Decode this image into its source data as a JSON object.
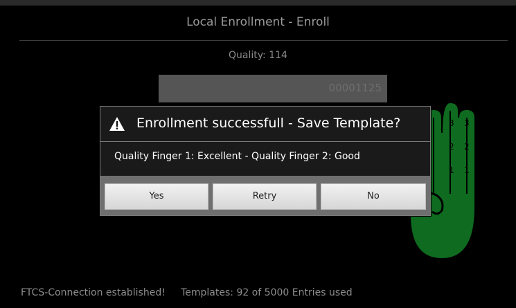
{
  "header": {
    "title": "Local Enrollment - Enroll"
  },
  "enrollment": {
    "quality_label": "Quality:",
    "quality_value": "114",
    "id_value": "00001125"
  },
  "hand": {
    "finger_labels": [
      "3",
      "3",
      "2",
      "2",
      "1",
      "1"
    ]
  },
  "dialog": {
    "title": "Enrollment successfull - Save Template?",
    "message": "Quality Finger 1: Excellent  -  Quality Finger 2: Good",
    "buttons": {
      "yes": "Yes",
      "retry": "Retry",
      "no": "No"
    }
  },
  "status": {
    "connection": "FTCS-Connection established!",
    "templates": "Templates: 92 of 5000 Entries used"
  },
  "colors": {
    "hand_fill": "#0e6b1f",
    "background": "#000000"
  }
}
